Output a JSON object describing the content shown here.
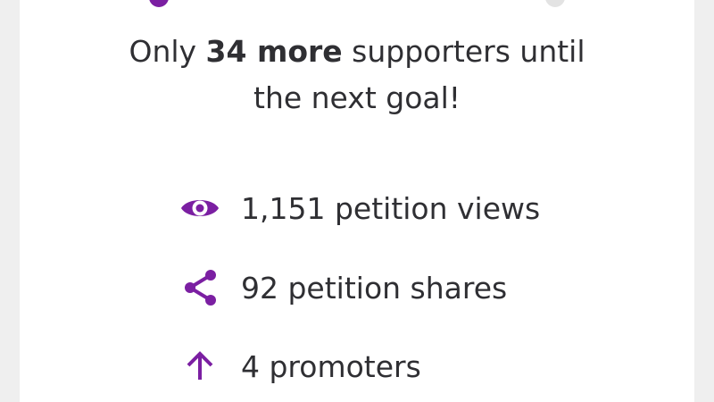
{
  "goal": {
    "prefix": "Only ",
    "count_bold": "34 more",
    "line1_suffix": " supporters until",
    "line2": "the next goal!"
  },
  "stats": [
    {
      "icon": "eye-icon",
      "label": "1,151 petition views"
    },
    {
      "icon": "share-icon",
      "label": "92 petition shares"
    },
    {
      "icon": "arrow-up-icon",
      "label": "4 promoters"
    }
  ],
  "colors": {
    "accent": "#7b1fa2",
    "text": "#2f2f33",
    "track_inactive": "#e3e3e3",
    "page_background": "#efefef",
    "card_background": "#ffffff"
  }
}
